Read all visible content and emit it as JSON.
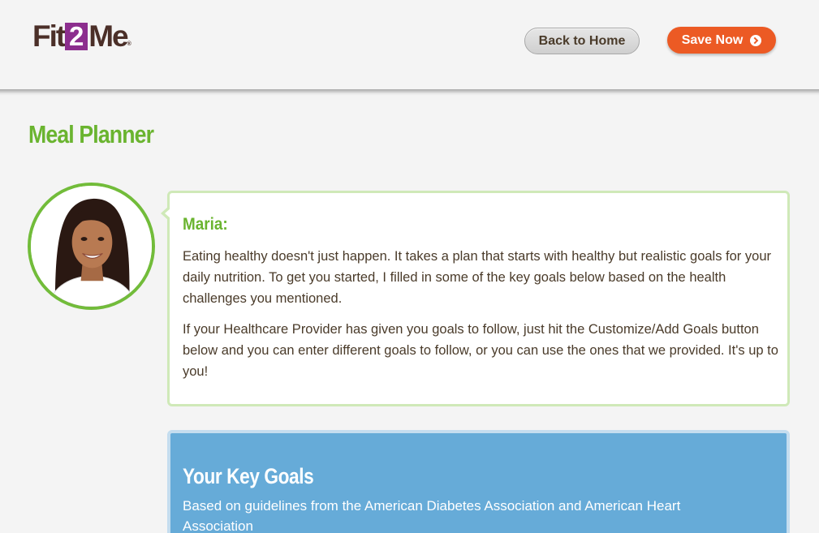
{
  "header": {
    "logo": {
      "part1": "Fit",
      "part2": "2",
      "part3": "Me",
      "trademark": "®"
    },
    "back_home_label": "Back to Home",
    "save_label": "Save Now",
    "save_icon": "arrow-right-circle-icon"
  },
  "page": {
    "title": "Meal Planner"
  },
  "coach": {
    "name": "Maria:",
    "avatar": "woman-portrait",
    "paragraphs": [
      "Eating healthy doesn't just happen. It takes a plan that starts with healthy but realistic goals for your daily nutrition. To get you started, I filled in some of the key goals below based on the health challenges you mentioned.",
      "If your Healthcare Provider has given you goals to follow, just hit the Customize/Add Goals button below and you can enter different goals to follow, or you can use the ones that we provided. It's up to you!"
    ]
  },
  "goals": {
    "title": "Your Key Goals",
    "subtitle": "Based on guidelines from the American Diabetes Association and American Heart Association"
  },
  "colors": {
    "brand_green": "#6ab42f",
    "brand_purple": "#8c2e8e",
    "brand_brown": "#4b2f28",
    "save_orange": "#ec5a24",
    "goals_blue": "#66abd8",
    "speech_border": "#cfe9b8"
  }
}
